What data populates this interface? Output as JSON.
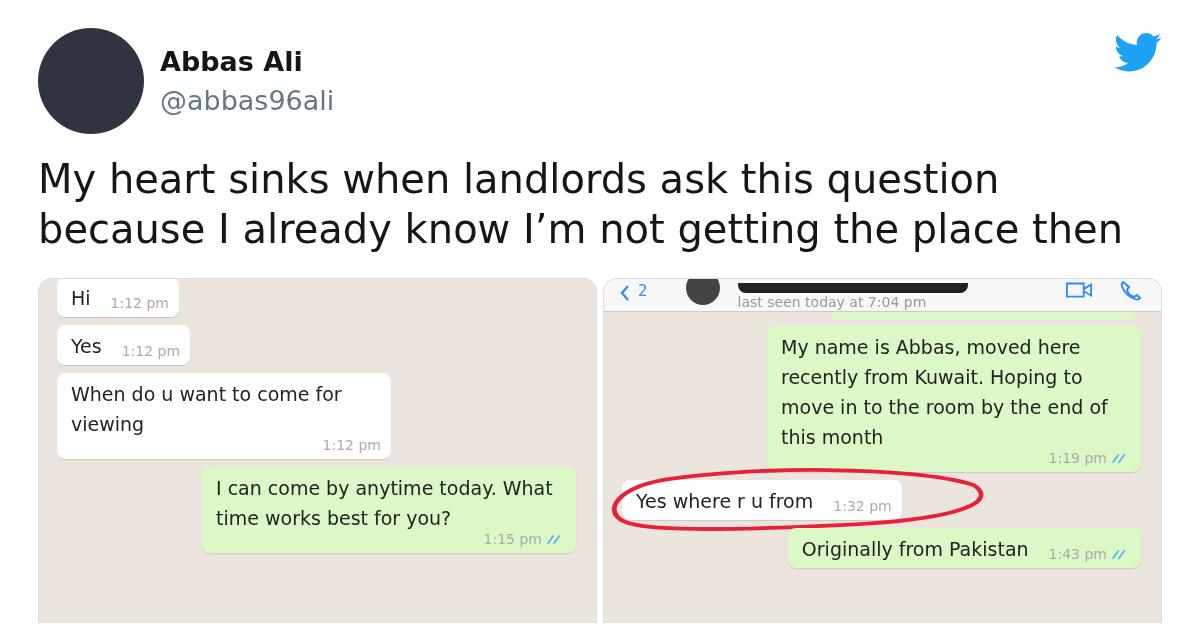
{
  "tweet": {
    "author": {
      "name": "Abbas Ali",
      "handle": "@abbas96ali"
    },
    "text": "My heart sinks when landlords ask this question because I already know I’m not getting the place then",
    "screenshots": [
      {
        "kind": "chat",
        "messages": [
          {
            "kind": "incoming",
            "text": "Hi",
            "time": "1:12 pm",
            "circled": false
          },
          {
            "kind": "incoming",
            "text": "Yes",
            "time": "1:12 pm",
            "circled": false
          },
          {
            "kind": "incoming",
            "text": "When do u want to come for viewing",
            "time": "1:12 pm",
            "circled": false
          },
          {
            "kind": "outgoing",
            "text": "I can come by anytime today. What time works best for you?",
            "time": "1:15 pm",
            "read": true,
            "circled": false
          }
        ]
      },
      {
        "kind": "chat_with_header",
        "header": {
          "back_count": "2",
          "status": "last seen today at 7:04 pm"
        },
        "messages": [
          {
            "kind": "outgoing",
            "text": "My name is Abbas, moved here recently from Kuwait. Hoping to move in to the room by the end of this month",
            "time": "1:19 pm",
            "read": true,
            "circled": false
          },
          {
            "kind": "incoming",
            "text": "Yes where r u from",
            "time": "1:32 pm",
            "circled": true
          },
          {
            "kind": "outgoing",
            "text": "Originally from Pakistan",
            "time": "1:43 pm",
            "read": true,
            "circled": false
          }
        ]
      }
    ]
  }
}
